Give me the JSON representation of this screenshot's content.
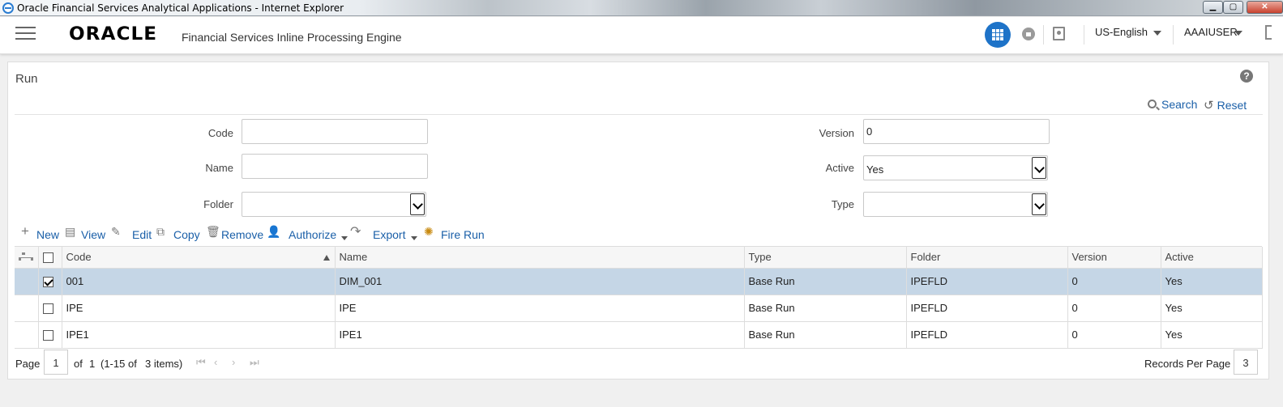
{
  "window": {
    "title": "Oracle Financial Services Analytical Applications - Internet Explorer"
  },
  "header": {
    "brand": "ORACLE",
    "product": "Financial Services Inline Processing Engine",
    "language": "US-English",
    "user": "AAAIUSER"
  },
  "page": {
    "title": "Run",
    "search_label": "Search",
    "reset_label": "Reset"
  },
  "filters": {
    "code": {
      "label": "Code",
      "value": ""
    },
    "name": {
      "label": "Name",
      "value": ""
    },
    "folder": {
      "label": "Folder",
      "value": ""
    },
    "version": {
      "label": "Version",
      "value": "0"
    },
    "active": {
      "label": "Active",
      "value": "Yes"
    },
    "type": {
      "label": "Type",
      "value": ""
    }
  },
  "toolbar": {
    "new": "New",
    "view": "View",
    "edit": "Edit",
    "copy": "Copy",
    "remove": "Remove",
    "authorize": "Authorize",
    "export": "Export",
    "fire_run": "Fire Run"
  },
  "grid": {
    "columns": [
      "Code",
      "Name",
      "Type",
      "Folder",
      "Version",
      "Active"
    ],
    "rows": [
      {
        "code": "001",
        "name": "DIM_001",
        "type": "Base Run",
        "folder": "IPEFLD",
        "version": "0",
        "active": "Yes",
        "checked": true
      },
      {
        "code": "IPE",
        "name": "IPE",
        "type": "Base Run",
        "folder": "IPEFLD",
        "version": "0",
        "active": "Yes",
        "checked": false
      },
      {
        "code": "IPE1",
        "name": "IPE1",
        "type": "Base Run",
        "folder": "IPEFLD",
        "version": "0",
        "active": "Yes",
        "checked": false
      }
    ]
  },
  "pager": {
    "page_label": "Page",
    "page": "1",
    "of_label": "of",
    "total_pages": "1",
    "range": "(1-15 of",
    "items": "3 items)",
    "records_label": "Records Per Page",
    "records": "3"
  },
  "colors": {
    "accent": "#1e73c8",
    "link": "#1a5fa8",
    "selected_row": "#c5d6e6"
  }
}
